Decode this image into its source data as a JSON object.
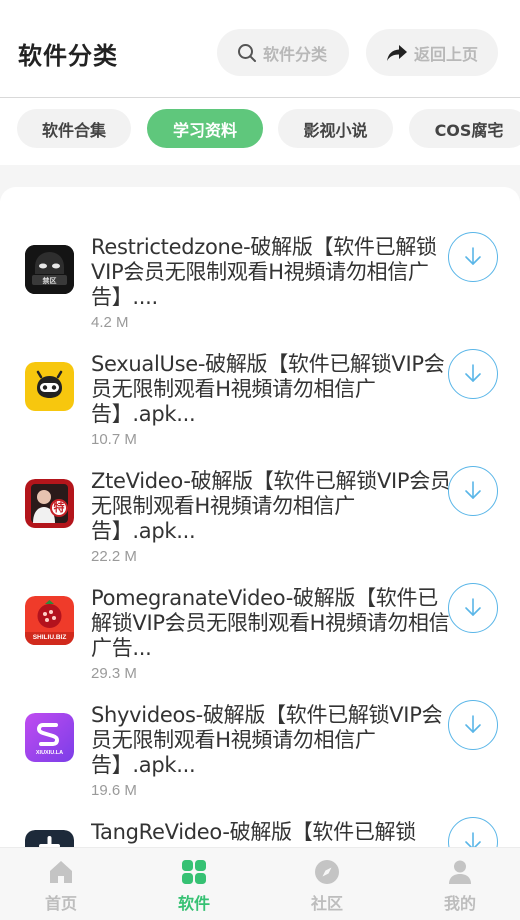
{
  "header": {
    "title": "软件分类",
    "search_label": "软件分类",
    "back_label": "返回上页"
  },
  "tabs": [
    {
      "label": "软件合集",
      "active": false
    },
    {
      "label": "学习资料",
      "active": true
    },
    {
      "label": "影视小说",
      "active": false
    },
    {
      "label": "COS腐宅",
      "active": false
    }
  ],
  "apps": [
    {
      "title": "Restrictedzone-破解版【软件已解锁VIP会员无限制观看H視頻请勿相信广告】....",
      "size": "4.2 M",
      "icon": "restrictedzone-app-icon",
      "icon_text": "禁区"
    },
    {
      "title": "SexualUse-破解版【软件已解锁VIP会员无限制观看H視頻请勿相信广告】.apk...",
      "size": "10.7 M",
      "icon": "sexualuse-app-icon",
      "icon_text": ""
    },
    {
      "title": "ZteVideo-破解版【软件已解锁VIP会员无限制观看H視頻请勿相信广告】.apk...",
      "size": "22.2 M",
      "icon": "ztevideo-app-icon",
      "icon_text": "特"
    },
    {
      "title": "PomegranateVideo-破解版【软件已解锁VIP会员无限制观看H視頻请勿相信广告...",
      "size": "29.3 M",
      "icon": "pomegranate-app-icon",
      "icon_text": "SHILIU.BIZ"
    },
    {
      "title": "Shyvideos-破解版【软件已解锁VIP会员无限制观看H視頻请勿相信广告】.apk...",
      "size": "19.6 M",
      "icon": "shyvideos-app-icon",
      "icon_text": "XIUXIU.LA"
    },
    {
      "title": "TangReVideo-破解版【软件已解锁",
      "size": "",
      "icon": "tangrevideo-app-icon",
      "icon_text": ""
    }
  ],
  "nav": [
    {
      "label": "首页",
      "icon": "home-icon",
      "active": false
    },
    {
      "label": "软件",
      "icon": "apps-grid-icon",
      "active": true
    },
    {
      "label": "社区",
      "icon": "compass-icon",
      "active": false
    },
    {
      "label": "我的",
      "icon": "user-icon",
      "active": false
    }
  ],
  "colors": {
    "accent_green": "#5fc77c",
    "nav_active": "#36c173",
    "download_blue": "#5ab6e8"
  }
}
